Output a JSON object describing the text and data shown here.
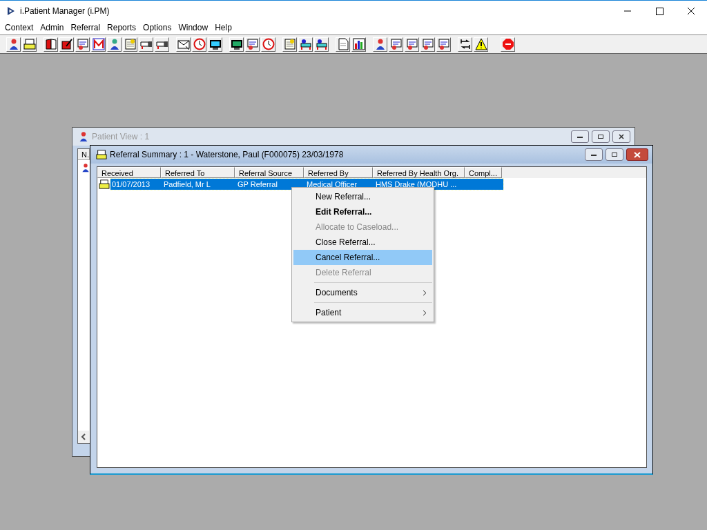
{
  "app": {
    "title": "i.Patient Manager (i.PM)"
  },
  "menu_bar": [
    "Context",
    "Admin",
    "Referral",
    "Reports",
    "Options",
    "Window",
    "Help"
  ],
  "patient_view": {
    "title": "Patient View : 1",
    "active": false,
    "columns": [
      "N."
    ]
  },
  "referral_summary": {
    "title": "Referral Summary : 1 - Waterstone, Paul (F000075) 23/03/1978",
    "active": true,
    "columns": [
      "Received",
      "Referred To",
      "Referral Source",
      "Referred By",
      "Referred By Health Org.",
      "Compl..."
    ],
    "rows": [
      {
        "selected": true,
        "cells": [
          "01/07/2013",
          "Padfield, Mr L",
          "GP Referral",
          "Medical Officer",
          "HMS Drake  (MODHU ...",
          ""
        ]
      }
    ]
  },
  "context_menu": [
    {
      "label": "New Referral...",
      "kind": "item",
      "bold": false,
      "disabled": false,
      "selected": false
    },
    {
      "label": "Edit Referral...",
      "kind": "item",
      "bold": true,
      "disabled": false,
      "selected": false
    },
    {
      "label": "Allocate to Caseload...",
      "kind": "item",
      "bold": false,
      "disabled": true,
      "selected": false
    },
    {
      "label": "Close Referral...",
      "kind": "item",
      "bold": false,
      "disabled": false,
      "selected": false
    },
    {
      "label": "Cancel Referral...",
      "kind": "item",
      "bold": false,
      "disabled": false,
      "selected": true
    },
    {
      "label": "Delete Referral",
      "kind": "item",
      "bold": false,
      "disabled": true,
      "selected": false
    },
    {
      "kind": "separator"
    },
    {
      "label": "Documents",
      "kind": "submenu",
      "bold": false,
      "disabled": false,
      "selected": false
    },
    {
      "kind": "separator"
    },
    {
      "label": "Patient",
      "kind": "submenu",
      "bold": false,
      "disabled": false,
      "selected": false
    }
  ]
}
